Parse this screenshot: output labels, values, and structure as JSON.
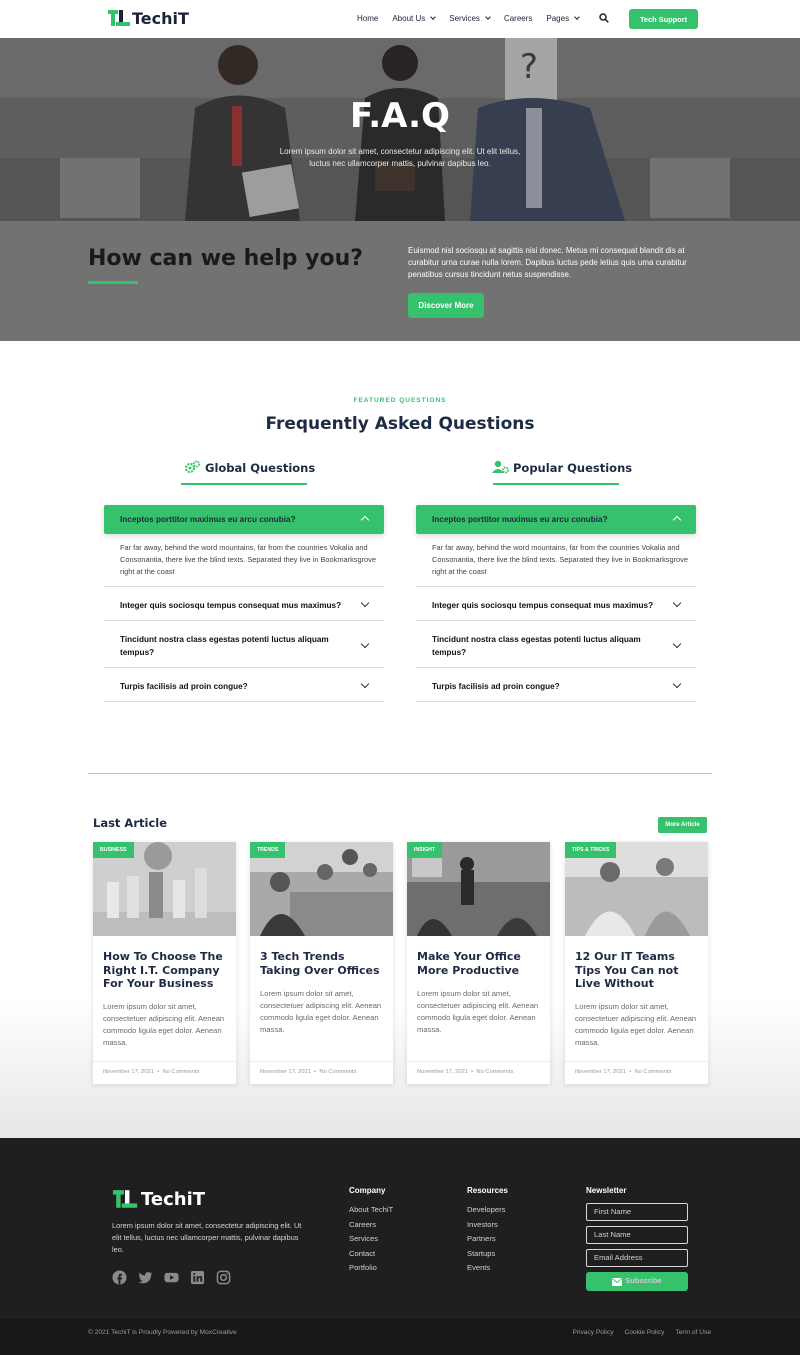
{
  "brand": {
    "name": "TechiT",
    "accent": "#36c26c",
    "dark": "#1f1f1f"
  },
  "nav": {
    "items": [
      {
        "label": "Home",
        "dropdown": false
      },
      {
        "label": "About Us",
        "dropdown": true
      },
      {
        "label": "Services",
        "dropdown": true
      },
      {
        "label": "Careers",
        "dropdown": false
      },
      {
        "label": "Pages",
        "dropdown": true
      }
    ],
    "search_icon": "search-icon",
    "cta_label": "Tech Support"
  },
  "hero": {
    "title": "F.A.Q",
    "subtitle": "Lorem ipsum dolor sit amet, consectetur adipiscing elit. Ut elit tellus, luctus nec ullamcorper mattis, pulvinar dapibus leo."
  },
  "help": {
    "title": "How can we help you?",
    "text": "Euismod nisl sociosqu at sagittis nisi donec. Metus mi consequat blandit dis at curabitur urna curae nulla lorem. Dapibus luctus pede letius quis uma curabitur penatibus cursus tincidunt netus suspendisse.",
    "button_label": "Discover More"
  },
  "faq": {
    "eyebrow": "FEATURED QUESTIONS",
    "title": "Frequently Asked Questions",
    "columns": [
      {
        "heading": "Global Questions",
        "icon": "gears-icon",
        "open": {
          "question": "Inceptos porttitor maximus eu arcu conubia?",
          "answer": "Far far away, behind the word mountains, far from the countries Vokalia and Consonantia, there live the blind texts. Separated they live in Bookmarksgrove right at the coast"
        },
        "items": [
          "Integer quis sociosqu tempus consequat mus maximus?",
          "Tincidunt nostra class egestas potenti luctus aliquam tempus?",
          "Turpis facilisis ad proin congue?"
        ]
      },
      {
        "heading": "Popular Questions",
        "icon": "user-gear-icon",
        "open": {
          "question": "Inceptos porttitor maximus eu arcu conubia?",
          "answer": "Far far away, behind the word mountains, far from the countries Vokalia and Consonantia, there live the blind texts. Separated they live in Bookmarksgrove right at the coast"
        },
        "items": [
          "Integer quis sociosqu tempus consequat mus maximus?",
          "Tincidunt nostra class egestas potenti luctus aliquam tempus?",
          "Turpis facilisis ad proin congue?"
        ]
      }
    ]
  },
  "articles": {
    "title": "Last Article",
    "more_label": "More Article",
    "cards": [
      {
        "tag": "BUSINESS",
        "title": "How To Choose The Right I.T. Company For Your Business",
        "excerpt": "Lorem ipsum dolor sit amet, consectetuer adipiscing elit. Aenean commodo ligula eget dolor. Aenean massa.",
        "date": "November 17, 2021",
        "comments": "No Comments"
      },
      {
        "tag": "TRENDS",
        "title": "3 Tech Trends Taking Over Offices",
        "excerpt": "Lorem ipsum dolor sit amet, consectetuer adipiscing elit. Aenean commodo ligula eget dolor. Aenean massa.",
        "date": "November 17, 2021",
        "comments": "No Comments"
      },
      {
        "tag": "INSIGHT",
        "title": "Make Your Office More Productive",
        "excerpt": "Lorem ipsum dolor sit amet, consectetuer adipiscing elit. Aenean commodo ligula eget dolor. Aenean massa.",
        "date": "November 17, 2021",
        "comments": "No Comments"
      },
      {
        "tag": "TIPS & TRICKS",
        "title": "12 Our IT Teams Tips You Can not Live Without",
        "excerpt": "Lorem ipsum dolor sit amet, consectetuer adipiscing elit. Aenean commodo ligula eget dolor. Aenean massa.",
        "date": "November 17, 2021",
        "comments": "No Comments"
      }
    ]
  },
  "footer": {
    "about": "Lorem ipsum dolor sit amet, consectetur adipiscing elit. Ut elit tellus, luctus nec ullamcorper mattis, pulvinar dapibus leo.",
    "socials": [
      "facebook-icon",
      "twitter-icon",
      "youtube-icon",
      "linkedin-icon",
      "instagram-icon"
    ],
    "company": {
      "heading": "Company",
      "links": [
        "About TechiT",
        "Careers",
        "Services",
        "Contact",
        "Portfolio"
      ]
    },
    "resources": {
      "heading": "Resources",
      "links": [
        "Developers",
        "Investors",
        "Partners",
        "Startups",
        "Events"
      ]
    },
    "newsletter": {
      "heading": "Newsletter",
      "first_name": "First Name",
      "last_name": "Last Name",
      "email": "Email Address",
      "button_label": "Subscribe"
    },
    "copyright": "© 2021 TechiT is Proudly Powered by MoxCreative",
    "legal": [
      "Privacy Policy",
      "Cookie Policy",
      "Term of Use"
    ]
  }
}
